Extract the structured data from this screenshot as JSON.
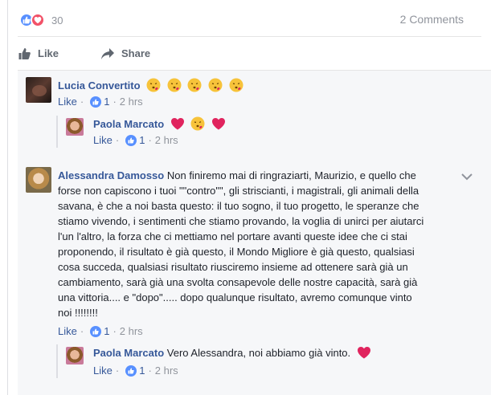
{
  "reactions": {
    "count": "30",
    "icons": [
      "like-icon",
      "love-icon"
    ]
  },
  "comments_count": "2 Comments",
  "actions": {
    "like": "Like",
    "share": "Share"
  },
  "comments": [
    {
      "author": "Lucia Convertito",
      "text": "",
      "emoji": [
        "kissing-face-emoji",
        "kissing-face-emoji",
        "kissing-face-emoji",
        "kissing-face-emoji",
        "kissing-face-emoji"
      ],
      "like": "Like",
      "likes": "1",
      "time": "2 hrs",
      "reply": {
        "author": "Paola Marcato",
        "text": "",
        "emoji": [
          "heart-emoji",
          "kissing-face-emoji",
          "heart-emoji"
        ],
        "like": "Like",
        "likes": "1",
        "time": "2 hrs"
      }
    },
    {
      "author": "Alessandra Damosso",
      "lines": [
        "Non finiremo mai di ringraziarti, Maurizio, e quello che",
        "forse non capiscono i tuoi \"\"contro\"\", gli striscianti, i magistrali, gli animali della",
        "savana, è che a noi basta questo: il tuo sogno, il tuo progetto, le speranze che",
        "stiamo vivendo, i sentimenti che stiamo provando, la voglia di unirci per aiutarci",
        "l'un l'altro, la forza che ci mettiamo nel portare avanti queste idee che ci stai",
        "proponendo, il risultato è già questo, il Mondo Migliore è già questo, qualsiasi",
        "cosa succeda, qualsiasi risultato riusciremo insieme ad ottenere sarà già un",
        "cambiamento, sarà già una svolta consapevole delle nostre capacità, sarà già",
        "una vittoria.... e \"dopo\"..... dopo qualunque risultato, avremo comunque vinto",
        "noi !!!!!!!!"
      ],
      "like": "Like",
      "likes": "1",
      "time": "2 hrs",
      "reply": {
        "author": "Paola Marcato",
        "text": "Vero Alessandra, noi abbiamo già vinto.",
        "emoji": [
          "heart-emoji"
        ],
        "like": "Like",
        "likes": "1",
        "time": "2 hrs"
      }
    }
  ],
  "colors": {
    "link": "#365899",
    "meta": "#90949c",
    "like_blue": "#5890ff",
    "love_red": "#f25268",
    "panel_bg": "#f6f7f9"
  }
}
